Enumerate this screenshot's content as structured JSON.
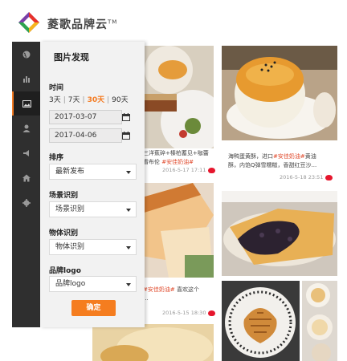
{
  "brand": {
    "name": "菱歌品牌云",
    "tm": "TM"
  },
  "sidebar": {
    "items": [
      {
        "icon": "globe-icon"
      },
      {
        "icon": "bar-chart-icon"
      },
      {
        "icon": "image-icon",
        "active": true
      },
      {
        "icon": "user-icon"
      },
      {
        "icon": "megaphone-icon"
      },
      {
        "icon": "home-icon"
      },
      {
        "icon": "gear-icon"
      }
    ]
  },
  "panel": {
    "title": "图片发现",
    "time_label": "时间",
    "ranges": [
      "3天",
      "7天",
      "30天",
      "90天"
    ],
    "active_range": "30天",
    "start_date": "2017-03-07",
    "end_date": "2017-04-06",
    "sort_label": "排序",
    "sort_value": "最新发布",
    "scene_label": "场景识别",
    "scene_placeholder": "场景识别",
    "object_label": "物体识别",
    "object_placeholder": "物体识别",
    "logo_label": "品牌logo",
    "logo_placeholder": "品牌logo",
    "confirm_label": "确定"
  },
  "posts": {
    "p1": {
      "caption_pre": "三洋蕉碎+榛柏蓄见+咖蕾",
      "caption_hl": "",
      "caption_post": "看布伦 ",
      "caption_tag": "#安佳奶油#",
      "date": "2016-5-17",
      "time": "17:11"
    },
    "p2": {
      "caption_pre": "海鸭蛋黄酥，进口",
      "caption_hl": "#安佳奶油#",
      "caption_post": "黄油",
      "line2": "酥，内馅Q弹雪糯糍，",
      "line2_hl": "香甜红豆沙...",
      "date": "2016-5-18",
      "time": "23:51"
    },
    "p3": {
      "caption_pre": "",
      "caption_hl": "#安佳奶油#",
      "caption_post": " 喜欢这个",
      "line2": "...",
      "date": "2016-5-15",
      "time": "18:30"
    }
  },
  "colors": {
    "accent": "#f47a20",
    "sidebar": "#2f2f2f",
    "panel": "#f2f2f2",
    "highlight": "#e0482a"
  }
}
